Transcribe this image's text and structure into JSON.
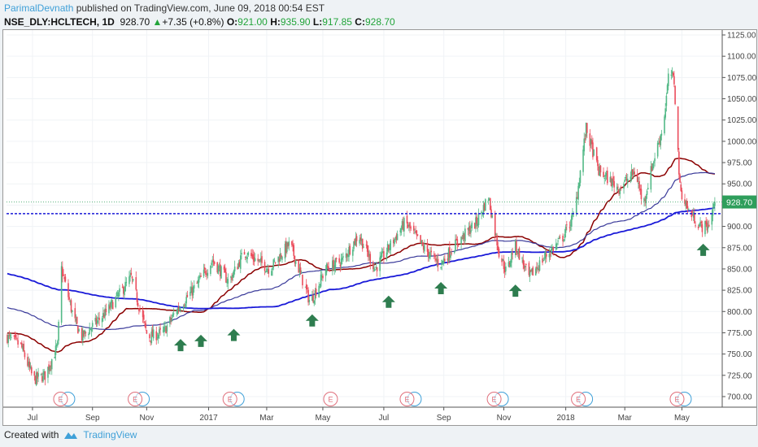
{
  "header": {
    "author": "ParimalDevnath",
    "published": " published on TradingView.com, June 09, 2018 00:54 EST",
    "symbol": "NSE_DLY:HCLTECH, 1D",
    "last": "928.70",
    "change": "+7.35 (+0.8%)",
    "o_label": "O:",
    "o": "921.00",
    "h_label": "H:",
    "h": "935.90",
    "l_label": "L:",
    "l": "917.85",
    "c_label": "C:",
    "c": "928.70"
  },
  "footer": {
    "created_with": "Created with",
    "brand": "TradingView"
  },
  "colors": {
    "up": "#53b987",
    "down": "#eb4d5c",
    "ma_short": "#8b0000",
    "ma_mid": "#3a3a9a",
    "ma_long": "#1a1ad8",
    "arrow": "#2e7d4f",
    "hline": "#1a1ad8",
    "last": "#2e9e5b"
  },
  "chart_data": {
    "type": "candlestick",
    "title": "NSE_DLY:HCLTECH, 1D",
    "ylim": [
      690,
      1130
    ],
    "y_ticks": [
      "1125.00",
      "1100.00",
      "1075.00",
      "1050.00",
      "1025.00",
      "1000.00",
      "975.00",
      "950.00",
      "925.00",
      "900.00",
      "875.00",
      "850.00",
      "825.00",
      "800.00",
      "775.00",
      "750.00",
      "725.00",
      "700.00"
    ],
    "y_tick_values": [
      1125,
      1100,
      1075,
      1050,
      1025,
      1000,
      975,
      950,
      925,
      900,
      875,
      850,
      825,
      800,
      775,
      750,
      725,
      700
    ],
    "x_ticks": [
      {
        "label": "Jul",
        "day": 26
      },
      {
        "label": "Sep",
        "day": 88
      },
      {
        "label": "Nov",
        "day": 144
      },
      {
        "label": "2017",
        "day": 208
      },
      {
        "label": "Mar",
        "day": 268
      },
      {
        "label": "May",
        "day": 326
      },
      {
        "label": "Jul",
        "day": 389
      },
      {
        "label": "Sep",
        "day": 451
      },
      {
        "label": "Nov",
        "day": 513
      },
      {
        "label": "2018",
        "day": 577
      },
      {
        "label": "Mar",
        "day": 638
      },
      {
        "label": "May",
        "day": 697
      }
    ],
    "x_range_days": [
      0,
      735
    ],
    "close_keypoints": [
      [
        0,
        770
      ],
      [
        14,
        760
      ],
      [
        27,
        720
      ],
      [
        39,
        725
      ],
      [
        52,
        760
      ],
      [
        56,
        850
      ],
      [
        69,
        790
      ],
      [
        77,
        770
      ],
      [
        103,
        800
      ],
      [
        128,
        840
      ],
      [
        145,
        770
      ],
      [
        161,
        775
      ],
      [
        174,
        800
      ],
      [
        195,
        830
      ],
      [
        212,
        860
      ],
      [
        229,
        835
      ],
      [
        245,
        870
      ],
      [
        271,
        850
      ],
      [
        292,
        880
      ],
      [
        313,
        810
      ],
      [
        329,
        850
      ],
      [
        346,
        860
      ],
      [
        363,
        890
      ],
      [
        380,
        850
      ],
      [
        397,
        880
      ],
      [
        411,
        905
      ],
      [
        430,
        875
      ],
      [
        447,
        855
      ],
      [
        464,
        880
      ],
      [
        485,
        905
      ],
      [
        497,
        935
      ],
      [
        508,
        870
      ],
      [
        516,
        845
      ],
      [
        524,
        880
      ],
      [
        539,
        840
      ],
      [
        556,
        865
      ],
      [
        573,
        885
      ],
      [
        586,
        915
      ],
      [
        598,
        1015
      ],
      [
        611,
        965
      ],
      [
        632,
        945
      ],
      [
        649,
        965
      ],
      [
        657,
        925
      ],
      [
        666,
        970
      ],
      [
        678,
        1020
      ],
      [
        684,
        1085
      ],
      [
        689,
        1070
      ],
      [
        695,
        945
      ],
      [
        703,
        920
      ],
      [
        716,
        900
      ],
      [
        724,
        900
      ],
      [
        731,
        928.7
      ]
    ],
    "moving_averages": [
      {
        "name": "MA short",
        "period": 50,
        "seed": 775
      },
      {
        "name": "MA mid",
        "period": 100,
        "seed": 805
      },
      {
        "name": "MA long",
        "period": 200,
        "seed": 845
      }
    ],
    "horizontal_line": 915,
    "last_price": 928.7,
    "last_price_label": "928.70",
    "buy_arrows": [
      [
        179,
        760
      ],
      [
        200,
        765
      ],
      [
        234,
        772
      ],
      [
        315,
        789
      ],
      [
        394,
        811
      ],
      [
        448,
        827
      ],
      [
        525,
        824
      ],
      [
        719,
        872
      ]
    ],
    "earnings_markers": [
      {
        "day": 55,
        "dividend": true
      },
      {
        "day": 132,
        "dividend": true
      },
      {
        "day": 230,
        "dividend": true
      },
      {
        "day": 334,
        "dividend": false
      },
      {
        "day": 413,
        "dividend": true
      },
      {
        "day": 503,
        "dividend": true
      },
      {
        "day": 590,
        "dividend": true
      },
      {
        "day": 692,
        "dividend": true
      }
    ],
    "earnings_label": "E"
  }
}
